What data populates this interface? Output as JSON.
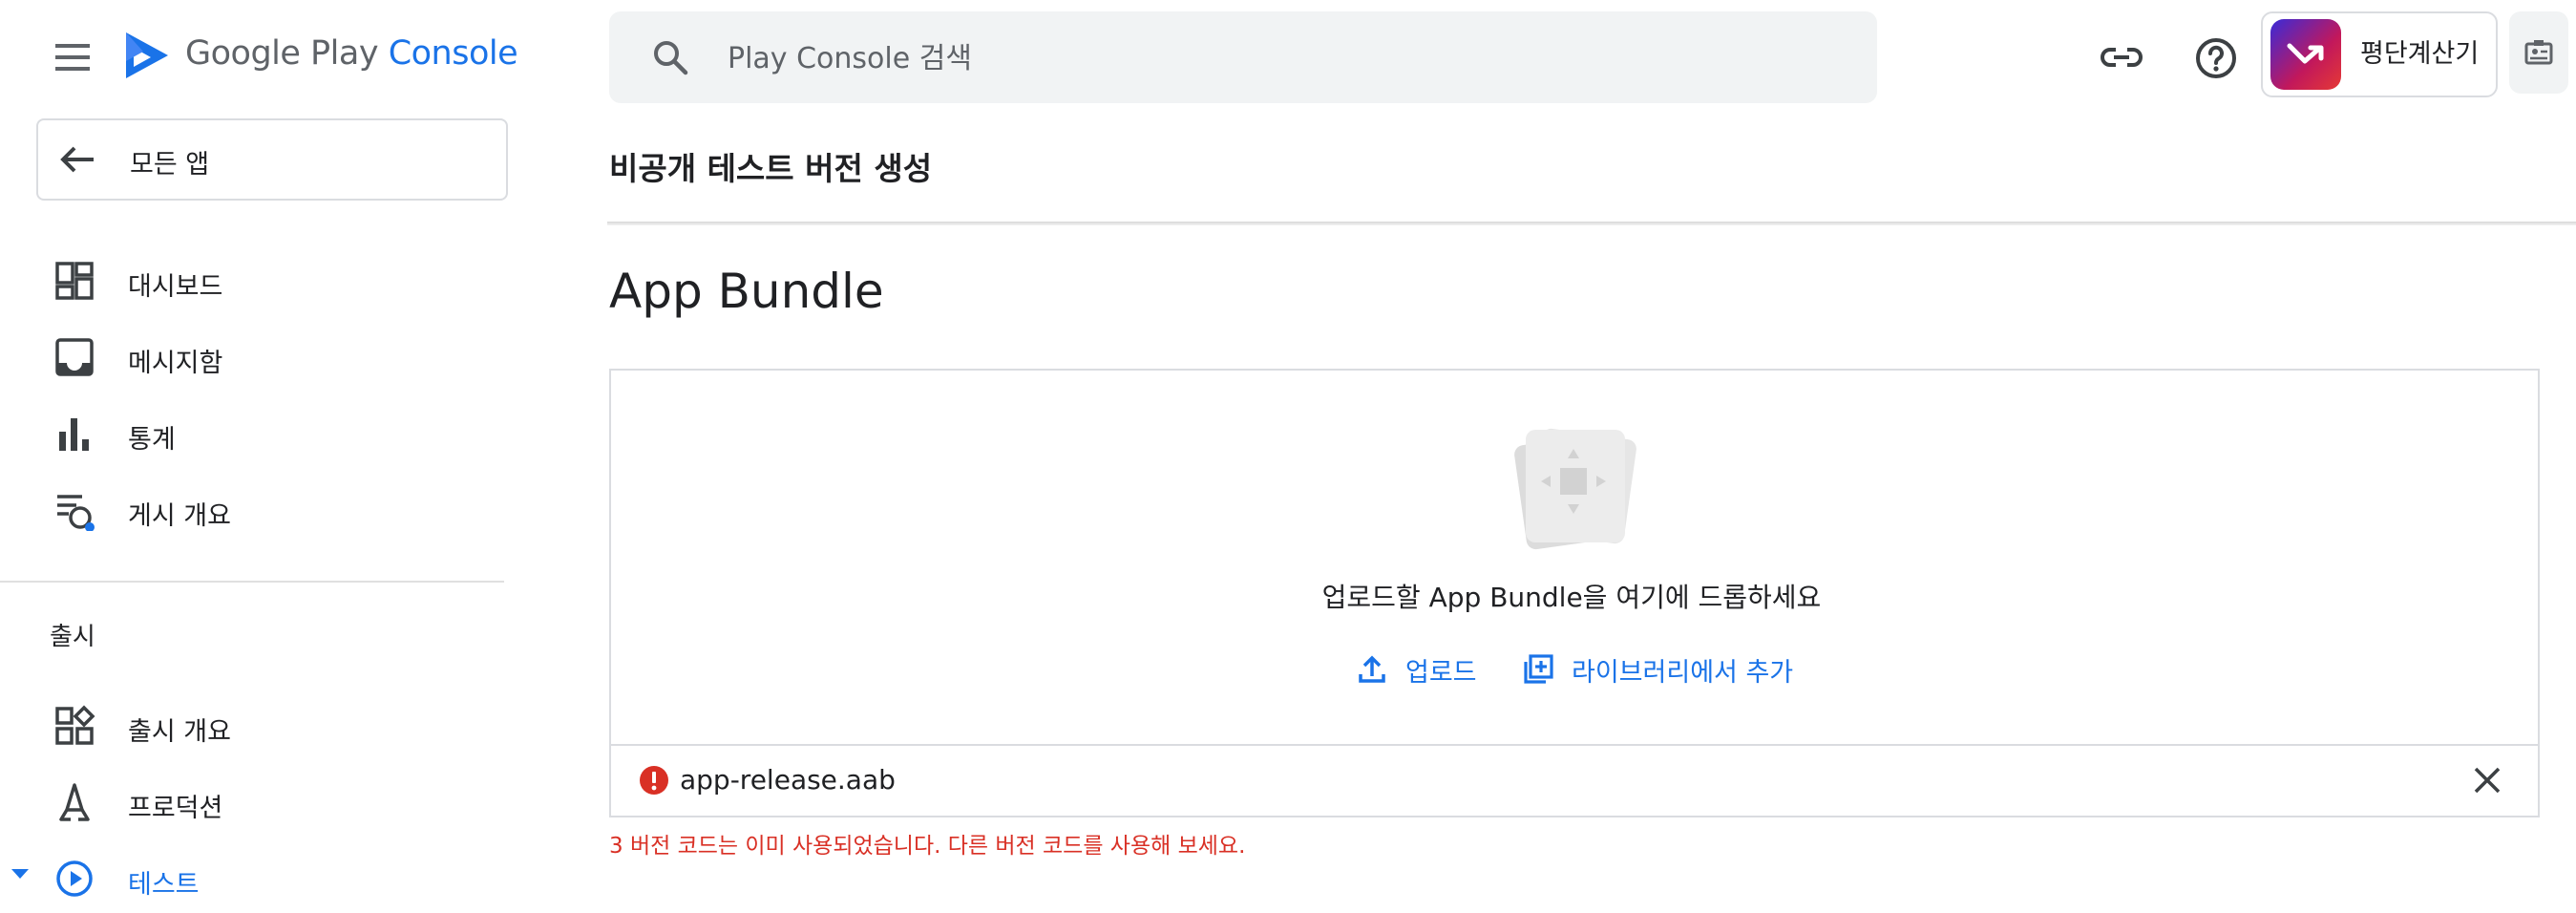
{
  "header": {
    "brand_prefix": "Google Play",
    "brand_suffix": "Console",
    "search_placeholder": "Play Console 검색",
    "app_name": "평단계산기"
  },
  "sidebar": {
    "all_apps_label": "모든 앱",
    "items_top": [
      {
        "label": "대시보드",
        "icon": "dashboard-icon"
      },
      {
        "label": "메시지함",
        "icon": "inbox-icon"
      },
      {
        "label": "통계",
        "icon": "statistics-icon"
      },
      {
        "label": "게시 개요",
        "icon": "publishing-overview-icon"
      }
    ],
    "section_label": "출시",
    "items_release": [
      {
        "label": "출시 개요",
        "icon": "release-overview-icon"
      },
      {
        "label": "프로덕션",
        "icon": "production-icon"
      },
      {
        "label": "테스트",
        "icon": "testing-icon"
      }
    ]
  },
  "main": {
    "page_title": "비공개 테스트 버전 생성",
    "section_heading": "App Bundle",
    "drop_text": "업로드할 App Bundle을 여기에 드롭하세요",
    "upload_label": "업로드",
    "library_label": "라이브러리에서 추가",
    "file_name": "app-release.aab",
    "error_message": "3 버전 코드는 이미 사용되었습니다. 다른 버전 코드를 사용해 보세요."
  },
  "colors": {
    "accent": "#1a73e8",
    "error": "#d93025",
    "search_bg": "#f1f3f4",
    "divider": "#dadce0"
  }
}
